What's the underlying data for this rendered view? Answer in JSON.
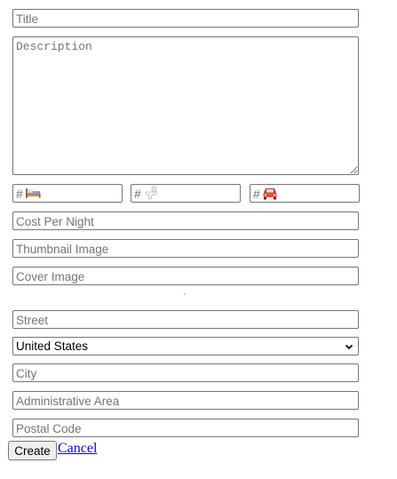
{
  "form": {
    "title_placeholder": "Title",
    "description_placeholder": "Description",
    "bedrooms_placeholder": "#",
    "bathrooms_placeholder": "#",
    "parking_placeholder": "#",
    "cost_placeholder": "Cost Per Night",
    "thumbnail_placeholder": "Thumbnail Image",
    "cover_placeholder": "Cover Image",
    "street_placeholder": "Street",
    "country_selected": "United States",
    "city_placeholder": "City",
    "admin_area_placeholder": "Administrative Area",
    "postal_placeholder": "Postal Code",
    "create_label": "Create",
    "cancel_label": "Cancel"
  },
  "icons": {
    "bedrooms": "bed-icon",
    "bathrooms": "toilet-icon",
    "parking": "car-icon"
  },
  "colors": {
    "link": "#0000ee",
    "border": "#767676",
    "placeholder": "#757575"
  }
}
